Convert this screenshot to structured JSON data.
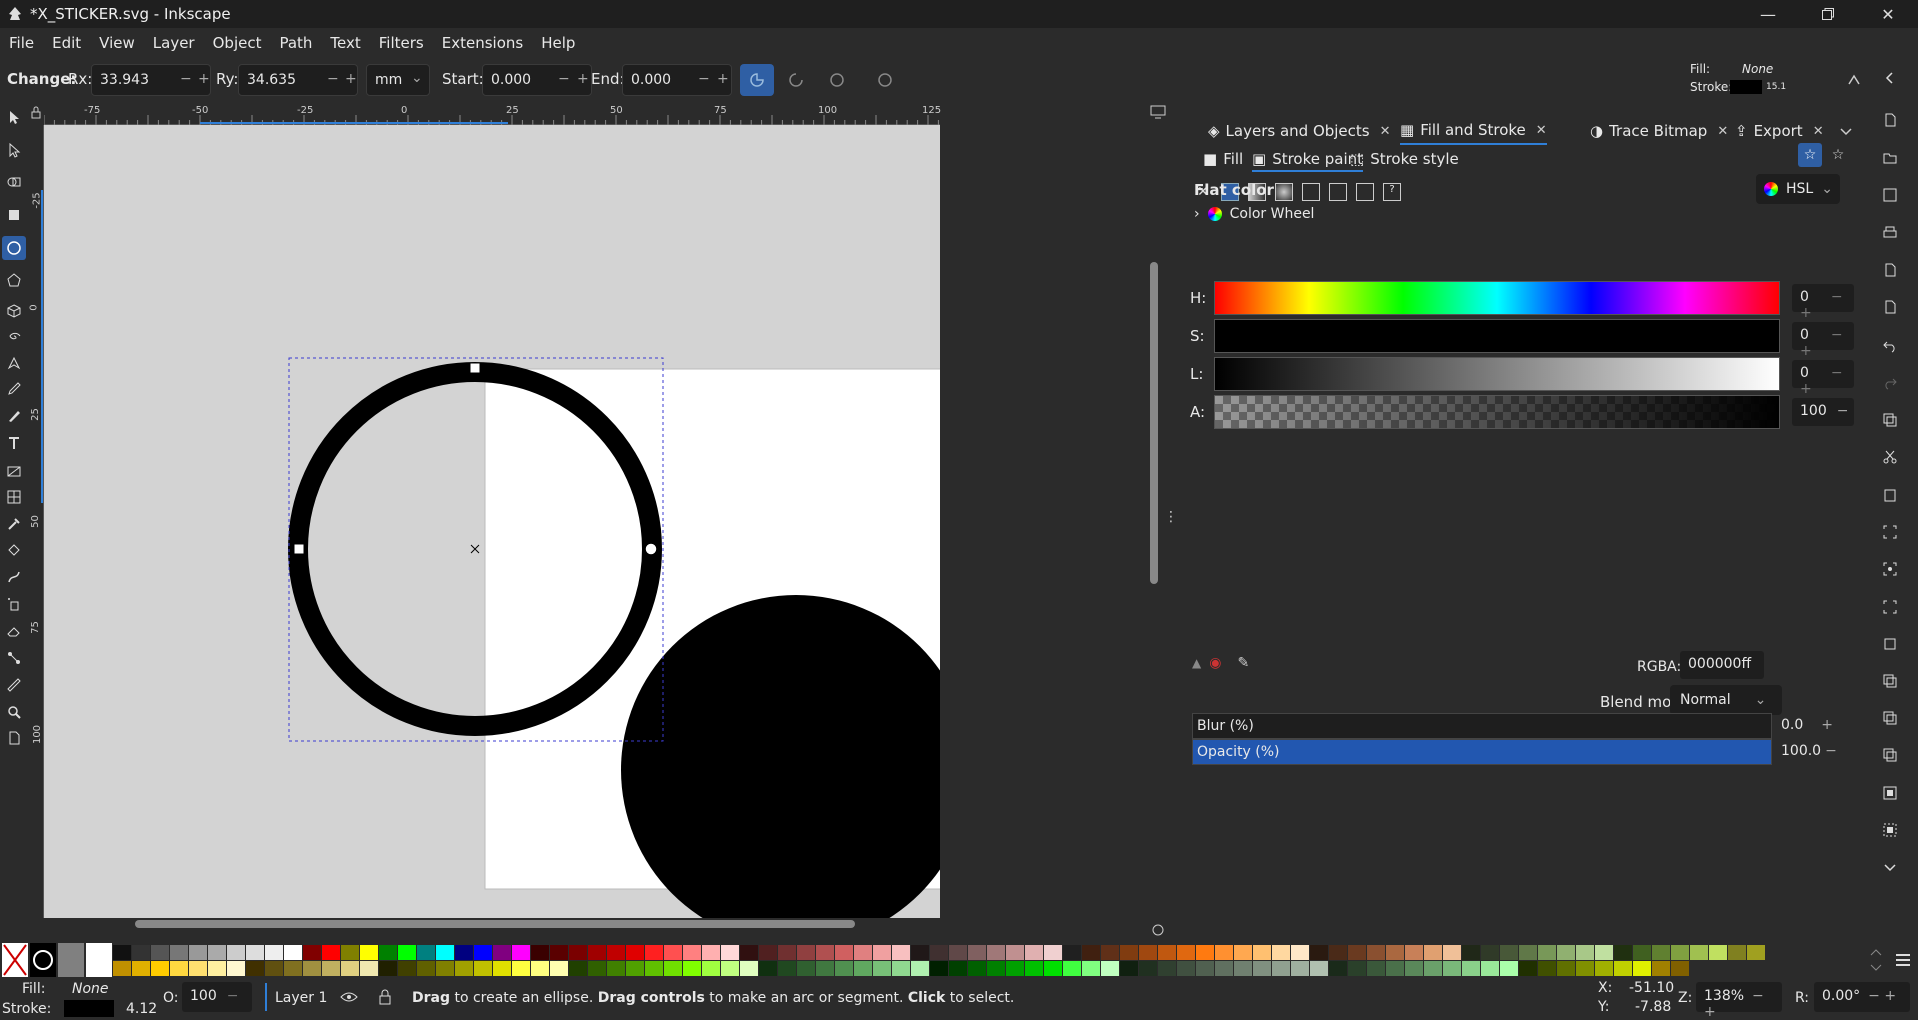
{
  "window": {
    "title": "*X_STICKER.svg - Inkscape",
    "min_icon": "minimize-icon",
    "max_icon": "restore-icon",
    "close_icon": "close-icon"
  },
  "menu": [
    "File",
    "Edit",
    "View",
    "Layer",
    "Object",
    "Path",
    "Text",
    "Filters",
    "Extensions",
    "Help"
  ],
  "tool_controls": {
    "change_label": "Change:",
    "rx_label": "Rx:",
    "rx_value": "33.943",
    "ry_label": "Ry:",
    "ry_value": "34.635",
    "unit": "mm",
    "start_label": "Start:",
    "start_value": "0.000",
    "end_label": "End:",
    "end_value": "0.000",
    "fill_label": "Fill:",
    "fill_value": "None",
    "stroke_label": "Stroke:",
    "stroke_width": "15.1"
  },
  "ruler_top": [
    "-75",
    "-50",
    "-25",
    "0",
    "25",
    "50",
    "75",
    "100",
    "125"
  ],
  "ruler_left": [
    "-25",
    "0",
    "25",
    "50",
    "75",
    "100"
  ],
  "dock": {
    "tabs": [
      "Layers and Objects",
      "Fill and Stroke",
      "Trace Bitmap",
      "Export"
    ],
    "subtabs": [
      "Fill",
      "Stroke paint",
      "Stroke style"
    ],
    "flat_color": "Flat color",
    "color_mode": "HSL",
    "color_wheel": "Color Wheel",
    "sliders": [
      {
        "label": "H:",
        "value": "0"
      },
      {
        "label": "S:",
        "value": "0"
      },
      {
        "label": "L:",
        "value": "0"
      },
      {
        "label": "A:",
        "value": "100"
      }
    ],
    "rgba_label": "RGBA:",
    "rgba_value": "000000ff",
    "blend_label": "Blend mode:",
    "blend_value": "Normal",
    "blur_label": "Blur (%)",
    "blur_value": "0.0",
    "opacity_label": "Opacity (%)",
    "opacity_value": "100.0",
    "opacity_level": 1.0
  },
  "status": {
    "fill_label": "Fill:",
    "fill_value": "None",
    "stroke_label": "Stroke:",
    "stroke_width": "4.12",
    "o_label": "O:",
    "o_value": "100",
    "layer": "Layer 1",
    "msg_b1": "Drag",
    "msg_t1": " to create an ellipse. ",
    "msg_b2": "Drag controls",
    "msg_t2": " to make an arc or segment. ",
    "msg_b3": "Click",
    "msg_t3": " to select.",
    "x_label": "X:",
    "x_value": "-51.10",
    "y_label": "Y:",
    "y_value": "-7.88",
    "z_label": "Z:",
    "z_value": "138%",
    "r_label": "R:",
    "r_value": "0.00°"
  },
  "colors": {
    "accent": "#2f5fa4",
    "canvas_bg": "#d3d3d3",
    "page": "#ffffff",
    "selection": "#3b3bd0"
  }
}
